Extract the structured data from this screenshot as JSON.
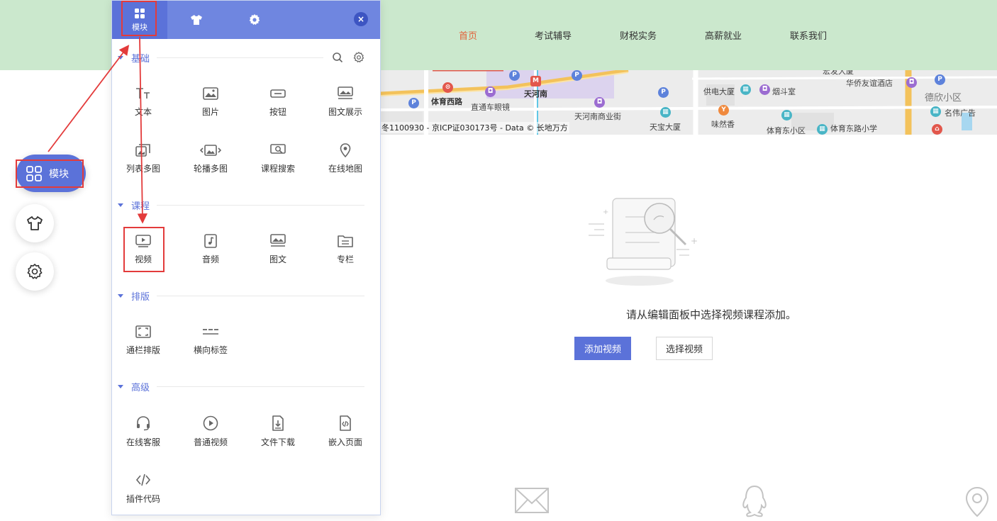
{
  "site": {
    "nav": [
      {
        "label": "首页",
        "active": true
      },
      {
        "label": "考试辅导",
        "active": false
      },
      {
        "label": "财税实务",
        "active": false
      },
      {
        "label": "高薪就业",
        "active": false
      },
      {
        "label": "联系我们",
        "active": false
      }
    ]
  },
  "map": {
    "labels": [
      "体育西路",
      "直通车眼镜",
      "天河南",
      "天河南商业街",
      "天宝大厦",
      "供电大厦",
      "烟斗室",
      "味然香",
      "体育东小区",
      "体育东路小学",
      "华侨友谊酒店",
      "德欣小区",
      "名伟广告",
      "宏发大厦"
    ],
    "copyright": "冬1100930 - 京ICP证030173号 - Data © 长地万方"
  },
  "empty_state": {
    "message": "请从编辑面板中选择视频课程添加。",
    "add_button": "添加视频",
    "select_button": "选择视频"
  },
  "float_toolbar": {
    "module_label": "模块"
  },
  "panel": {
    "tabs": {
      "module": "模块"
    },
    "sections": [
      {
        "title": "基础",
        "items": [
          "文本",
          "图片",
          "按钮",
          "图文展示",
          "列表多图",
          "轮播多图",
          "课程搜索",
          "在线地图"
        ]
      },
      {
        "title": "课程",
        "items": [
          "视频",
          "音频",
          "图文",
          "专栏"
        ]
      },
      {
        "title": "排版",
        "items": [
          "通栏排版",
          "横向标签"
        ]
      },
      {
        "title": "高级",
        "items": [
          "在线客服",
          "普通视频",
          "文件下载",
          "嵌入页面",
          "插件代码"
        ]
      }
    ]
  },
  "colors": {
    "accent": "#5b72d9",
    "header_bg": "#cbe8cd",
    "nav_active": "#e2623a",
    "annotation_red": "#e33b3b"
  }
}
